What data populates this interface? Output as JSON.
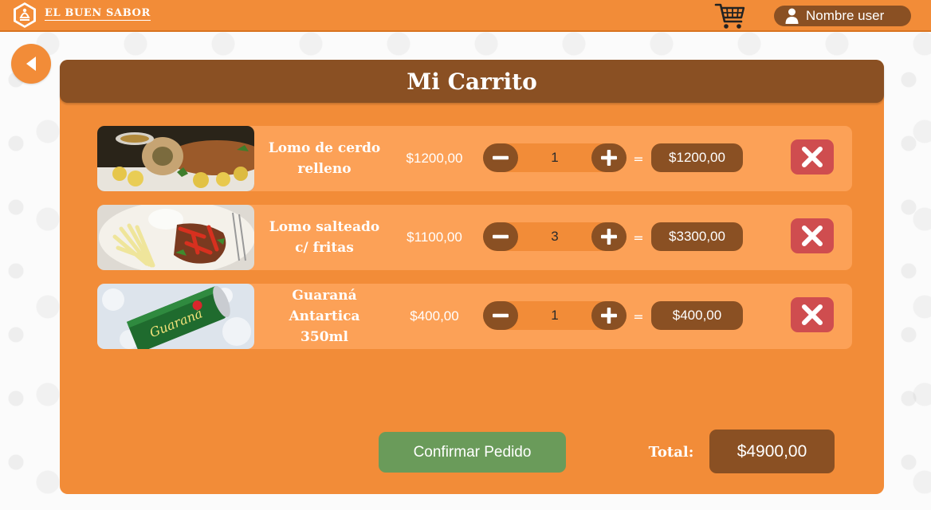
{
  "brand": {
    "name": "EL BUEN SABOR",
    "logo_icon": "chef-hat-icon"
  },
  "header": {
    "user_name": "Nombre user",
    "cart_icon": "shopping-cart-icon",
    "user_icon": "user-icon"
  },
  "back_icon": "back-arrow-icon",
  "page": {
    "title": "Mi Carrito"
  },
  "cart": {
    "items": [
      {
        "name": "Lomo de cerdo relleno",
        "price": "$1200,00",
        "quantity": "1",
        "subtotal": "$1200,00",
        "image": "stuffed-pork-loin-photo"
      },
      {
        "name": "Lomo salteado c/ fritas",
        "price": "$1100,00",
        "quantity": "3",
        "subtotal": "$3300,00",
        "image": "lomo-salteado-photo"
      },
      {
        "name": "Guaraná Antartica 350ml",
        "price": "$400,00",
        "quantity": "1",
        "subtotal": "$400,00",
        "image": "guarana-can-photo"
      }
    ],
    "equals_sign": "=",
    "confirm_label": "Confirmar Pedido",
    "total_label": "Total:",
    "total_value": "$4900,00"
  },
  "colors": {
    "primary_orange": "#f28c38",
    "row_orange": "#fca157",
    "brown": "#8a5023",
    "confirm_green": "#6a9b5a",
    "remove_red": "#cf4d4f"
  }
}
